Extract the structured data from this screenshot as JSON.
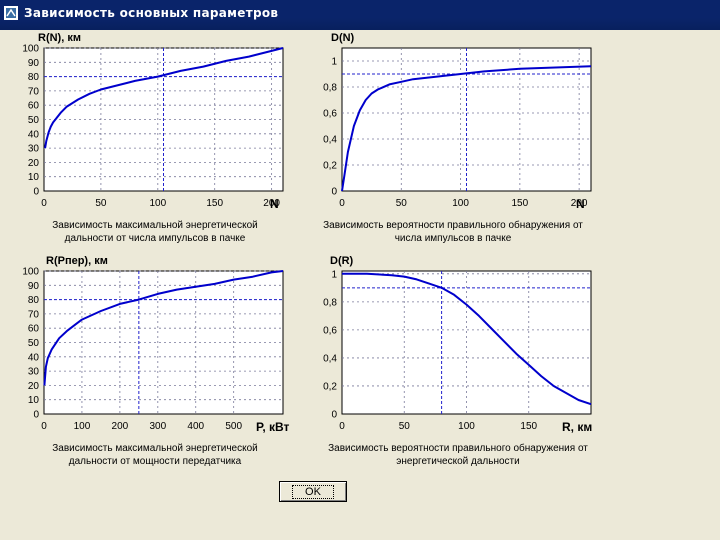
{
  "window": {
    "title": "Зависимость основных параметров"
  },
  "ok_button": "OK",
  "colors": {
    "curve": "#0000cc",
    "titlebar": "#0a246a",
    "background": "#ece9d8"
  },
  "chart_data": [
    {
      "type": "line",
      "title": "R(N), км",
      "xlabel": "N",
      "caption_lines": [
        "Зависимость максимальной энергетической",
        "дальности от числа импульсов в пачке"
      ],
      "xlim": [
        0,
        210
      ],
      "ylim": [
        0,
        100
      ],
      "xticks": [
        0,
        50,
        100,
        150,
        200
      ],
      "yticks": [
        0,
        10,
        20,
        30,
        40,
        50,
        60,
        70,
        80,
        90,
        100
      ],
      "yticklabels": [
        "0",
        "10",
        "20",
        "30",
        "40",
        "50",
        "60",
        "70",
        "80",
        "90",
        "100"
      ],
      "ref_x": 105,
      "ref_y": 80,
      "x": [
        1,
        2,
        4,
        6,
        8,
        10,
        15,
        20,
        30,
        40,
        50,
        60,
        80,
        100,
        120,
        140,
        160,
        180,
        200,
        210
      ],
      "y": [
        30,
        35,
        41,
        45,
        48,
        50,
        55,
        59,
        64,
        68,
        71,
        73,
        77,
        80,
        84,
        87,
        91,
        94,
        98,
        100
      ]
    },
    {
      "type": "line",
      "title": "D(N)",
      "xlabel": "N",
      "caption_lines": [
        "Зависимость вероятности правильного обнаружения от",
        "числа импульсов в пачке"
      ],
      "xlim": [
        0,
        210
      ],
      "ylim": [
        0,
        1.1
      ],
      "xticks": [
        0,
        50,
        100,
        150,
        200
      ],
      "yticks": [
        0,
        0.2,
        0.4,
        0.6,
        0.8,
        1
      ],
      "yticklabels": [
        "0",
        "0,2",
        "0,4",
        "0,6",
        "0,8",
        "1"
      ],
      "ref_x": 105,
      "ref_y": 0.9,
      "x": [
        0,
        2,
        5,
        10,
        15,
        20,
        25,
        30,
        40,
        50,
        60,
        80,
        100,
        120,
        150,
        180,
        210
      ],
      "y": [
        0,
        0.12,
        0.3,
        0.5,
        0.62,
        0.7,
        0.75,
        0.78,
        0.82,
        0.84,
        0.86,
        0.88,
        0.9,
        0.92,
        0.94,
        0.95,
        0.96
      ]
    },
    {
      "type": "line",
      "title": "R(Рпер), км",
      "xlabel": "Р, кВт",
      "caption_lines": [
        "Зависимость максимальной энергетической",
        "дальности от мощности передатчика"
      ],
      "xlim": [
        0,
        630
      ],
      "ylim": [
        0,
        100
      ],
      "xticks": [
        0,
        100,
        200,
        300,
        400,
        500
      ],
      "yticks": [
        0,
        10,
        20,
        30,
        40,
        50,
        60,
        70,
        80,
        90,
        100
      ],
      "yticklabels": [
        "0",
        "10",
        "20",
        "30",
        "40",
        "50",
        "60",
        "70",
        "80",
        "90",
        "100"
      ],
      "ref_x": 250,
      "ref_y": 80,
      "x": [
        1,
        5,
        10,
        20,
        40,
        60,
        80,
        100,
        150,
        200,
        250,
        300,
        350,
        400,
        450,
        500,
        550,
        600,
        630
      ],
      "y": [
        20,
        33,
        39,
        45,
        53,
        58,
        62,
        66,
        72,
        77,
        80,
        84,
        87,
        89,
        91,
        94,
        96,
        99,
        100
      ]
    },
    {
      "type": "line",
      "title": "D(R)",
      "xlabel": "R, км",
      "caption_lines": [
        "Зависимость вероятности правильного обнаружения от",
        "энергетической дальности"
      ],
      "xlim": [
        0,
        200
      ],
      "ylim": [
        0,
        1.02
      ],
      "xticks": [
        0,
        50,
        100,
        150
      ],
      "yticks": [
        0,
        0.2,
        0.4,
        0.6,
        0.8,
        1
      ],
      "yticklabels": [
        "0",
        "0,2",
        "0,4",
        "0,6",
        "0,8",
        "1"
      ],
      "ref_x": 80,
      "ref_y": 0.9,
      "x": [
        0,
        20,
        40,
        50,
        60,
        70,
        80,
        90,
        100,
        110,
        120,
        130,
        140,
        150,
        160,
        170,
        180,
        190,
        200
      ],
      "y": [
        1.0,
        1.0,
        0.99,
        0.98,
        0.96,
        0.93,
        0.9,
        0.85,
        0.78,
        0.7,
        0.61,
        0.52,
        0.43,
        0.35,
        0.27,
        0.2,
        0.15,
        0.1,
        0.07
      ]
    }
  ]
}
